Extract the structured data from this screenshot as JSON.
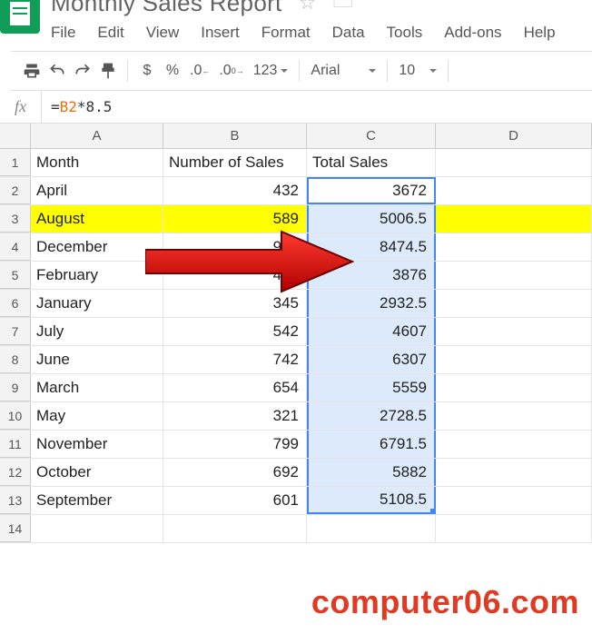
{
  "doc": {
    "title": "Monthly Sales Report"
  },
  "menus": [
    "File",
    "Edit",
    "View",
    "Insert",
    "Format",
    "Data",
    "Tools",
    "Add-ons",
    "Help"
  ],
  "toolbar": {
    "currency": "$",
    "percent": "%",
    "font": "Arial",
    "font_size": "10"
  },
  "formula_bar": {
    "fx": "fx",
    "ref": "B2",
    "rest": "*8.5"
  },
  "columns": [
    "A",
    "B",
    "C",
    "D"
  ],
  "rows": [
    {
      "n": 1,
      "a": "Month",
      "b": "Number of Sales",
      "c": "Total Sales",
      "d": ""
    },
    {
      "n": 2,
      "a": "April",
      "b": "432",
      "c": "3672",
      "d": ""
    },
    {
      "n": 3,
      "a": "August",
      "b": "589",
      "c": "5006.5",
      "d": "",
      "hl": true
    },
    {
      "n": 4,
      "a": "December",
      "b": "997",
      "c": "8474.5",
      "d": ""
    },
    {
      "n": 5,
      "a": "February",
      "b": "456",
      "c": "3876",
      "d": ""
    },
    {
      "n": 6,
      "a": "January",
      "b": "345",
      "c": "2932.5",
      "d": ""
    },
    {
      "n": 7,
      "a": "July",
      "b": "542",
      "c": "4607",
      "d": ""
    },
    {
      "n": 8,
      "a": "June",
      "b": "742",
      "c": "6307",
      "d": ""
    },
    {
      "n": 9,
      "a": "March",
      "b": "654",
      "c": "5559",
      "d": ""
    },
    {
      "n": 10,
      "a": "May",
      "b": "321",
      "c": "2728.5",
      "d": ""
    },
    {
      "n": 11,
      "a": "November",
      "b": "799",
      "c": "6791.5",
      "d": ""
    },
    {
      "n": 12,
      "a": "October",
      "b": "692",
      "c": "5882",
      "d": ""
    },
    {
      "n": 13,
      "a": "September",
      "b": "601",
      "c": "5108.5",
      "d": ""
    },
    {
      "n": 14,
      "a": "",
      "b": "",
      "c": "",
      "d": ""
    }
  ],
  "icons": {
    "print": "print-icon",
    "undo": "undo-icon",
    "redo": "redo-icon",
    "paint": "paint-format-icon",
    "dec_dec": ".0",
    "inc_dec": ".00",
    "num_fmt": "123",
    "star": "☆",
    "folder": "🗀"
  },
  "watermark": "computer06.com"
}
